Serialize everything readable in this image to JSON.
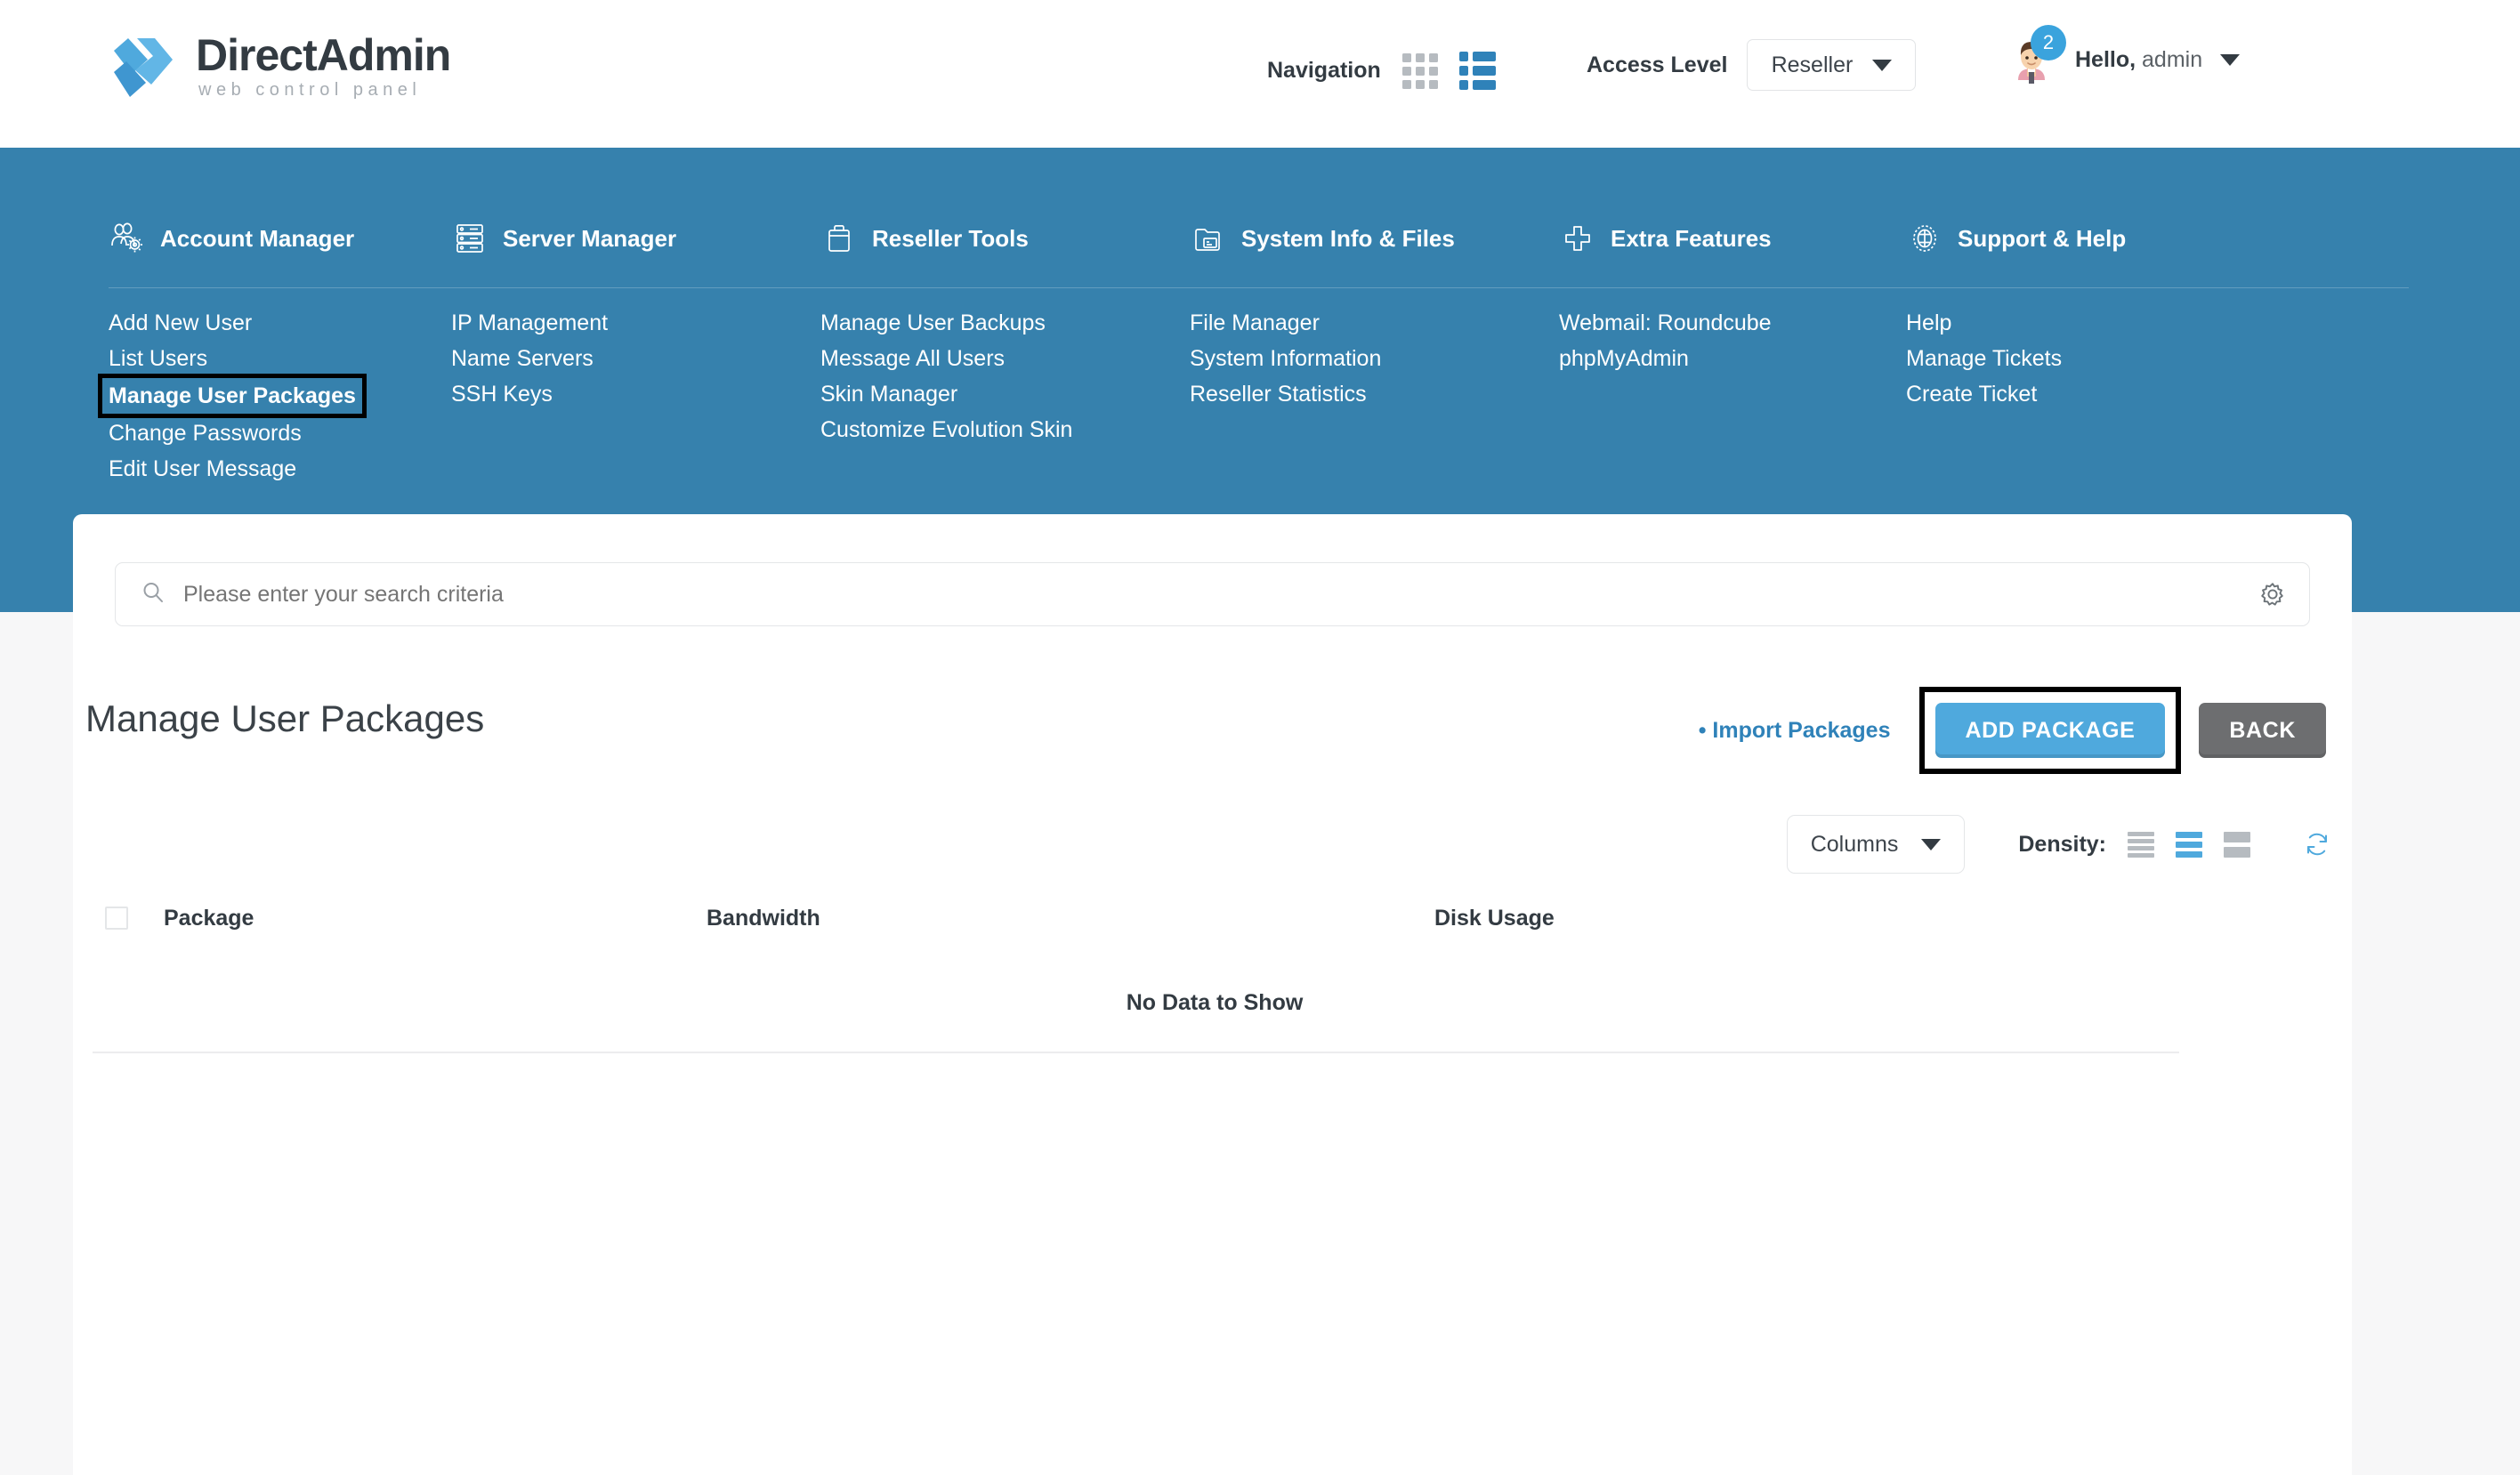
{
  "header": {
    "logo": {
      "title_a": "Direct",
      "title_b": "Admin",
      "subtitle": "web control panel"
    },
    "navigation_label": "Navigation",
    "grid_view_icon": "grid-view-icon",
    "list_view_icon": "list-view-icon",
    "access_level_label": "Access Level",
    "access_level_value": "Reseller",
    "user_greeting_prefix": "Hello,",
    "user_name": "admin",
    "notification_count": "2"
  },
  "nav": {
    "columns": [
      {
        "title": "Account Manager",
        "icon": "users-gear-icon",
        "items": [
          {
            "label": "Add New User",
            "highlighted": false
          },
          {
            "label": "List Users",
            "highlighted": false
          },
          {
            "label": "Manage User Packages",
            "highlighted": true
          },
          {
            "label": "Change Passwords",
            "highlighted": false
          },
          {
            "label": "Edit User Message",
            "highlighted": false
          }
        ]
      },
      {
        "title": "Server Manager",
        "icon": "server-rack-icon",
        "items": [
          {
            "label": "IP Management",
            "highlighted": false
          },
          {
            "label": "Name Servers",
            "highlighted": false
          },
          {
            "label": "SSH Keys",
            "highlighted": false
          }
        ]
      },
      {
        "title": "Reseller Tools",
        "icon": "briefcase-icon",
        "items": [
          {
            "label": "Manage User Backups",
            "highlighted": false
          },
          {
            "label": "Message All Users",
            "highlighted": false
          },
          {
            "label": "Skin Manager",
            "highlighted": false
          },
          {
            "label": "Customize Evolution Skin",
            "highlighted": false
          }
        ]
      },
      {
        "title": "System Info & Files",
        "icon": "folder-file-icon",
        "items": [
          {
            "label": "File Manager",
            "highlighted": false
          },
          {
            "label": "System Information",
            "highlighted": false
          },
          {
            "label": "Reseller Statistics",
            "highlighted": false
          }
        ]
      },
      {
        "title": "Extra Features",
        "icon": "plus-icon",
        "items": [
          {
            "label": "Webmail: Roundcube",
            "highlighted": false
          },
          {
            "label": "phpMyAdmin",
            "highlighted": false
          }
        ]
      },
      {
        "title": "Support & Help",
        "icon": "lifebuoy-icon",
        "items": [
          {
            "label": "Help",
            "highlighted": false
          },
          {
            "label": "Manage Tickets",
            "highlighted": false
          },
          {
            "label": "Create Ticket",
            "highlighted": false
          }
        ]
      }
    ]
  },
  "search": {
    "placeholder": "Please enter your search criteria",
    "value": "",
    "search_icon": "search-icon",
    "settings_icon": "gear-icon"
  },
  "main": {
    "page_title": "Manage User Packages",
    "import_link": "• Import Packages",
    "add_button": "ADD PACKAGE",
    "back_button": "BACK",
    "columns_button": "Columns",
    "density_label": "Density:",
    "refresh_icon": "refresh-icon",
    "table": {
      "headers": [
        "Package",
        "Bandwidth",
        "Disk Usage"
      ],
      "rows": [],
      "empty_message": "No Data to Show"
    }
  },
  "colors": {
    "banner_blue": "#3681ad",
    "accent_blue": "#4fa9dd",
    "link_blue": "#2f82b9",
    "secondary_gray": "#6d6e70",
    "text_dark": "#333b42",
    "page_bg": "#f7f7f8"
  }
}
